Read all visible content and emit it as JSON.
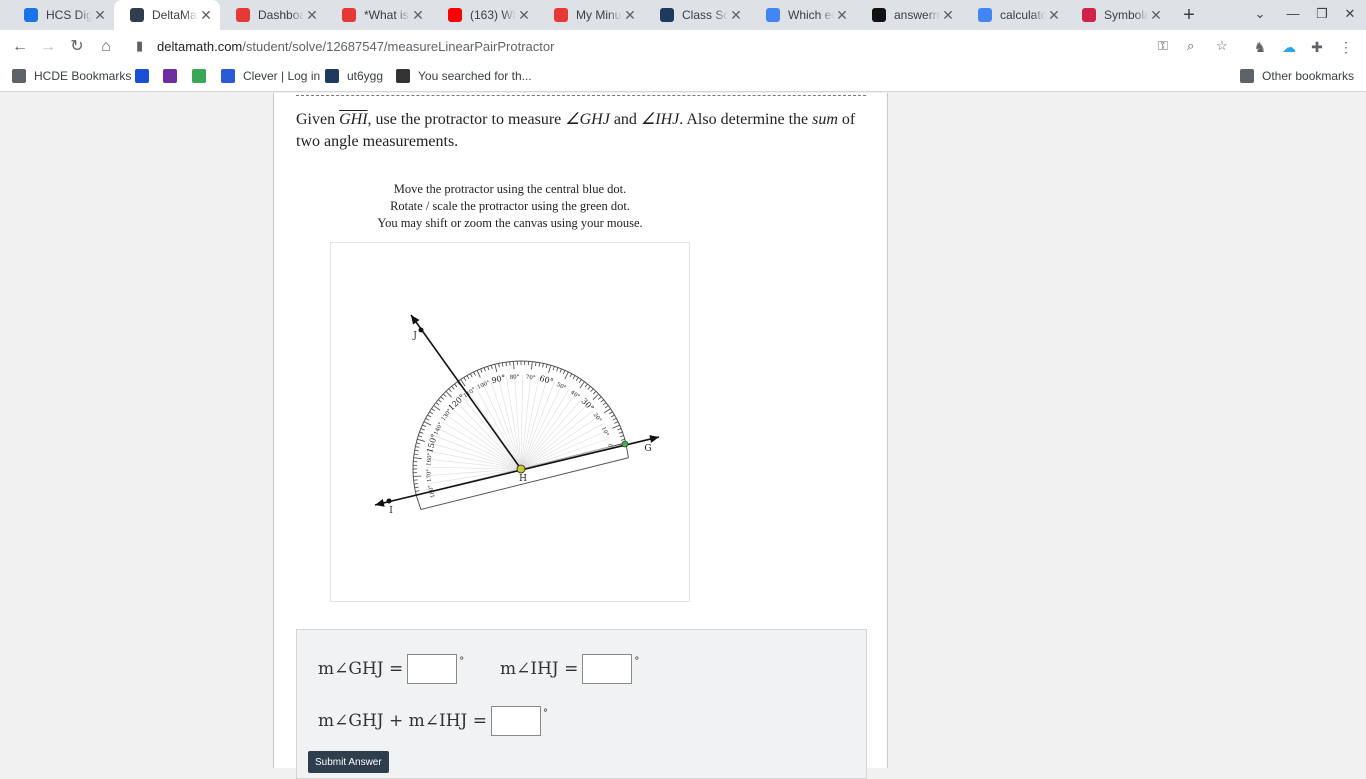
{
  "browser": {
    "tabs": [
      {
        "title": "HCS Digit",
        "fav_color": "#1a73e8"
      },
      {
        "title": "DeltaMat",
        "fav_color": "#2f3e4e"
      },
      {
        "title": "Dashboar",
        "fav_color": "#e53935"
      },
      {
        "title": "*What is",
        "fav_color": "#e53935"
      },
      {
        "title": "(163) Wh",
        "fav_color": "#ff0000"
      },
      {
        "title": "My Minut",
        "fav_color": "#e53935"
      },
      {
        "title": "Class Sco",
        "fav_color": "#1f3a5f"
      },
      {
        "title": "Which eq",
        "fav_color": "#4285f4"
      },
      {
        "title": "answerrn",
        "fav_color": "#111111"
      },
      {
        "title": "calculato",
        "fav_color": "#4285f4"
      },
      {
        "title": "Symbola",
        "fav_color": "#d0234a"
      }
    ],
    "close_glyph": "✕",
    "url_host": "deltamath.com",
    "url_path": "/student/solve/12687547/measureLinearPairProtractor",
    "bookmarks": [
      {
        "label": "HCDE Bookmarks",
        "color": "#5f6368"
      },
      {
        "label": "",
        "color": "#1a4fd6"
      },
      {
        "label": "",
        "color": "#6b2fa0"
      },
      {
        "label": "",
        "color": "#3aa757"
      },
      {
        "label": "Clever | Log in",
        "color": "#2a5bd7"
      },
      {
        "label": "ut6ygg",
        "color": "#1f3a5f"
      },
      {
        "label": "You searched for th...",
        "color": "#333333"
      }
    ],
    "other_bookmarks": "Other bookmarks"
  },
  "problem": {
    "given": "Given",
    "segment": "GHI",
    "text1": ", use the protractor to measure",
    "angle1": "∠GHJ",
    "and": "and",
    "angle2": "∠IHJ",
    "text2": ". Also determine the",
    "sum_word": "sum",
    "text3": "of two angle measurements."
  },
  "instructions": [
    "Move the protractor using the central blue dot.",
    "Rotate / scale the protractor using the green dot.",
    "You may shift or zoom the canvas using your mouse."
  ],
  "diagram": {
    "points": {
      "J": "J",
      "H": "H",
      "G": "G",
      "I": "I"
    },
    "protractor_labels": [
      "0°",
      "10°",
      "20°",
      "30°",
      "40°",
      "50°",
      "60°",
      "70°",
      "80°",
      "90°",
      "100°",
      "110°",
      "120°",
      "130°",
      "140°",
      "150°",
      "160°",
      "170°",
      "180°"
    ],
    "colors": {
      "rotate_handle": "#39b54a",
      "center_dot": "#c8c832"
    }
  },
  "answers": {
    "eq1_label": "m∠GHJ =",
    "eq2_label": "m∠IHJ =",
    "eq3_label": "m∠GHJ + m∠IHJ =",
    "eq1_value": "",
    "eq2_value": "",
    "eq3_value": "",
    "degree": "°",
    "submit_label": "Submit Answer"
  }
}
